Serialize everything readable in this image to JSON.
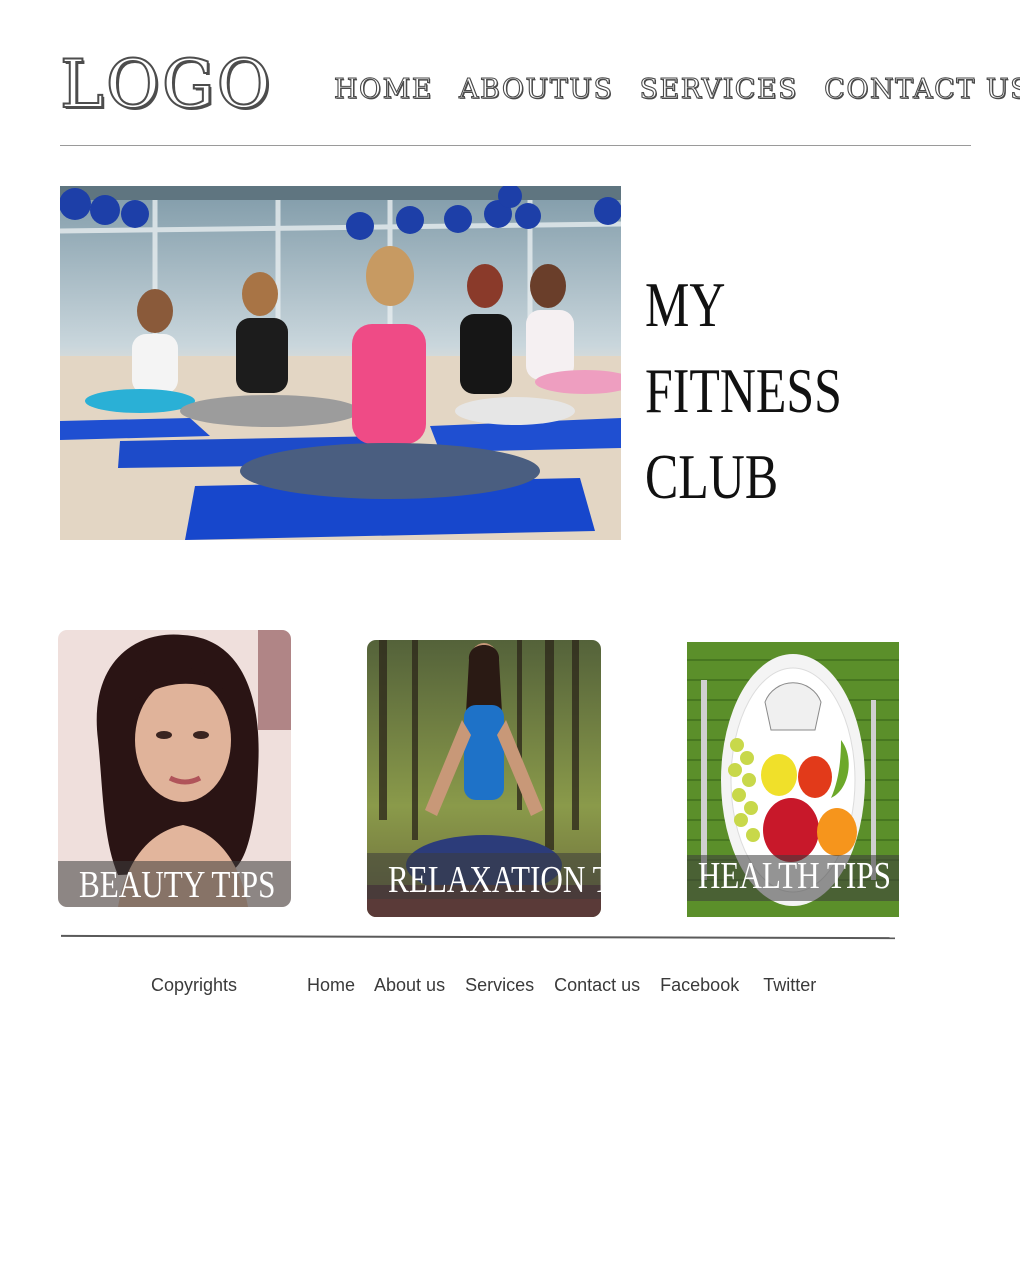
{
  "header": {
    "logo": "LOGO",
    "nav": [
      "HOME",
      "ABOUTUS",
      "SERVICES",
      "CONTACT US"
    ]
  },
  "hero": {
    "title": "MY FITNESS\nCLUB"
  },
  "tips": [
    {
      "label": "BEAUTY TIPS"
    },
    {
      "label": "RELAXATION TIPS"
    },
    {
      "label": "HEALTH TIPS"
    }
  ],
  "footer": {
    "copyright": "Copyrights",
    "links": [
      "Home",
      "About us",
      "Services",
      "Contact us",
      "Facebook",
      "Twitter"
    ]
  },
  "colors": {
    "text_dark": "#3a3a3a",
    "mat_blue": "#1f4fd1",
    "divider": "#9a9a9a"
  }
}
